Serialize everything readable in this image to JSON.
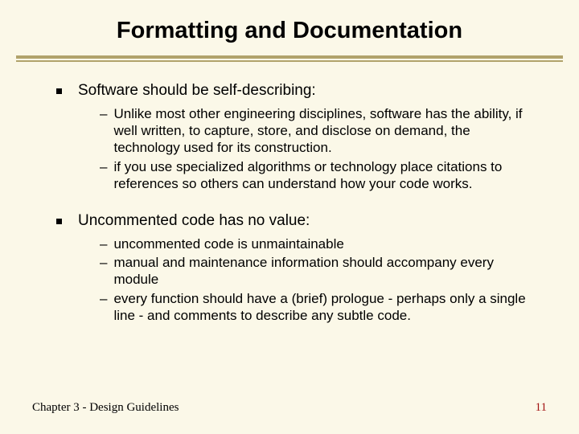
{
  "title": "Formatting and Documentation",
  "bullets": [
    {
      "text": "Software should be self-describing:",
      "subs": [
        "Unlike most other engineering disciplines, software has the ability, if well written, to capture, store, and disclose on demand, the technology used for its construction.",
        "if you use specialized algorithms or technology place citations to references so others can understand how your code works."
      ]
    },
    {
      "text": "Uncommented code has no value:",
      "subs": [
        "uncommented code is unmaintainable",
        "manual and maintenance information should accompany every module",
        "every function should have a (brief) prologue - perhaps only a single line - and comments to describe any subtle code."
      ]
    }
  ],
  "footer_left": "Chapter 3 - Design Guidelines",
  "footer_right": "11"
}
